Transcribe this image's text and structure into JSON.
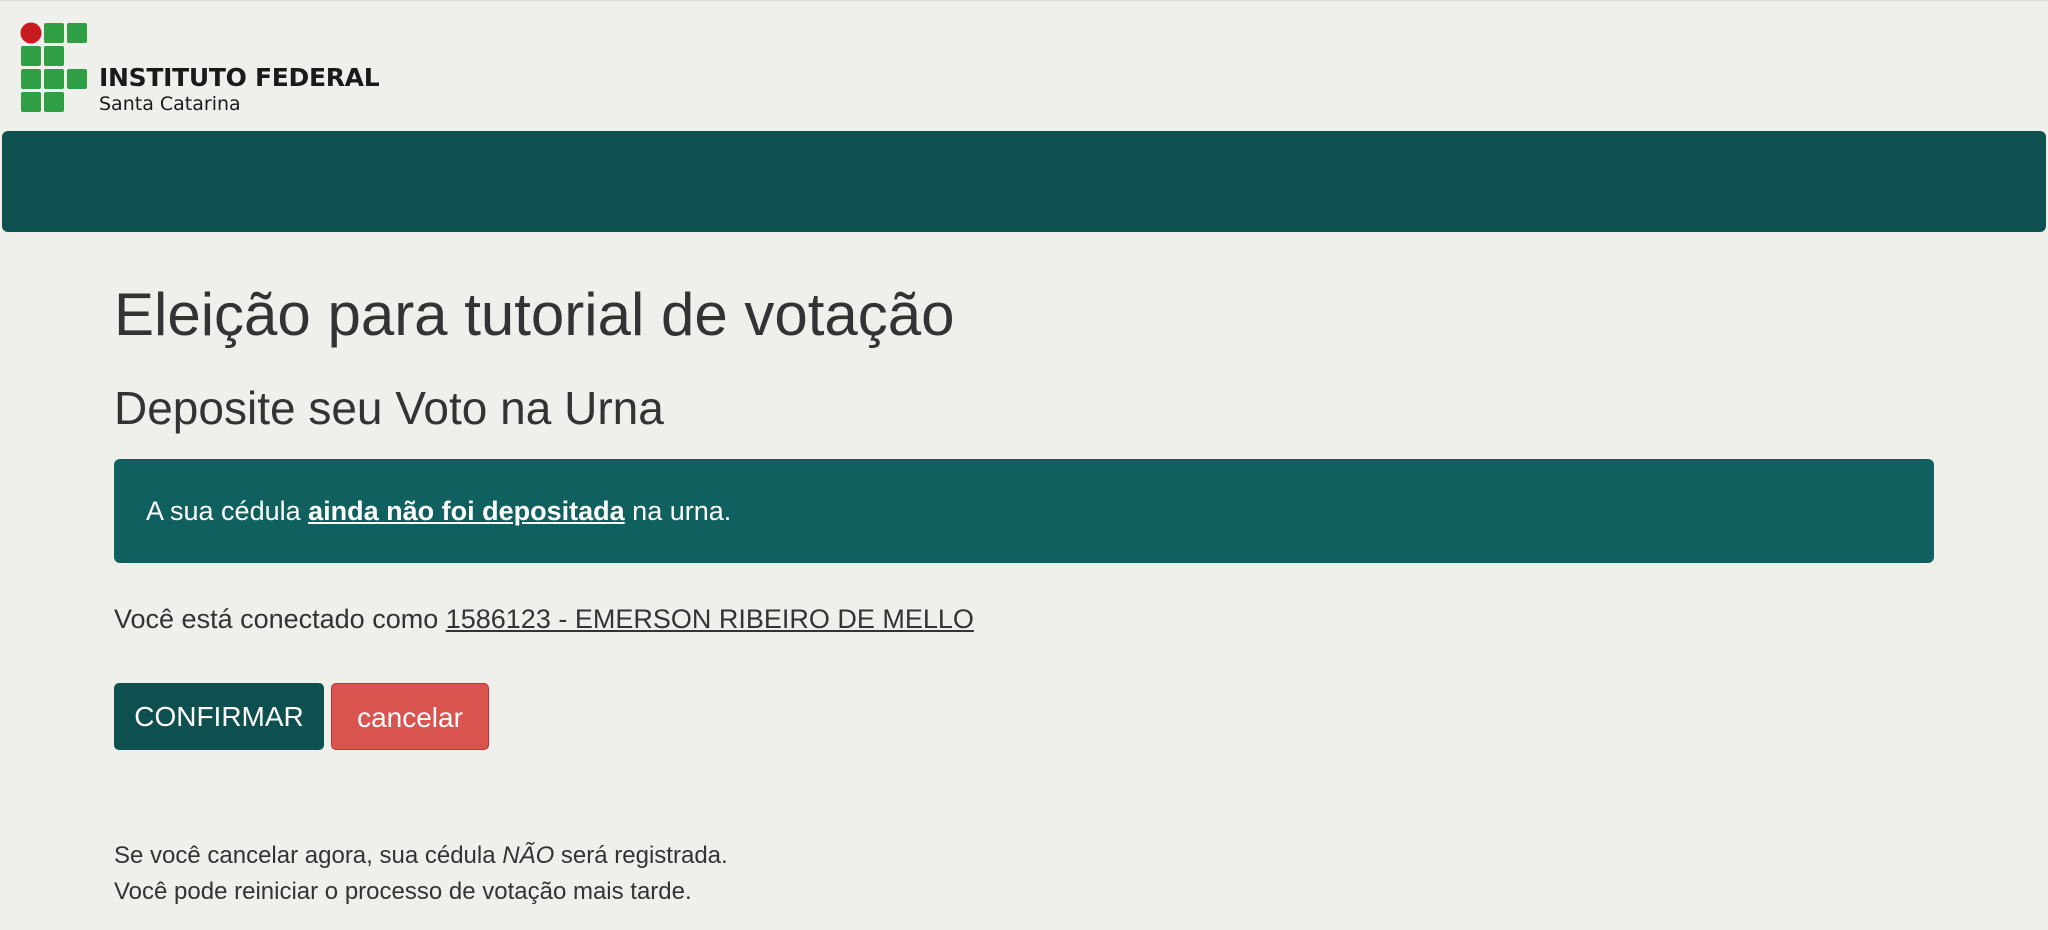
{
  "header": {
    "logo_title": "INSTITUTO FEDERAL",
    "logo_subtitle": "Santa Catarina",
    "logo_icon": "ifsc-logo-icon"
  },
  "colors": {
    "background": "#eff0ec",
    "navbar": "#0e504f",
    "alert": "#116060",
    "confirm_button": "#0e504f",
    "cancel_button": "#d9534f",
    "logo_green": "#2f9e44",
    "logo_red": "#c8191e"
  },
  "main": {
    "title": "Eleição para tutorial de votação",
    "subtitle": "Deposite seu Voto na Urna",
    "alert": {
      "prefix": "A sua cédula ",
      "emphasis": "ainda não foi depositada",
      "suffix": " na urna."
    },
    "user": {
      "prefix": "Você está conectado como ",
      "name": "1586123 - EMERSON RIBEIRO DE MELLO"
    },
    "buttons": {
      "confirm": "CONFIRMAR",
      "cancel": "cancelar"
    },
    "note": {
      "line1_prefix": "Se você cancelar agora, sua cédula ",
      "line1_emphasis": "NÃO",
      "line1_suffix": " será registrada.",
      "line2": "Você pode reiniciar o processo de votação mais tarde."
    }
  }
}
